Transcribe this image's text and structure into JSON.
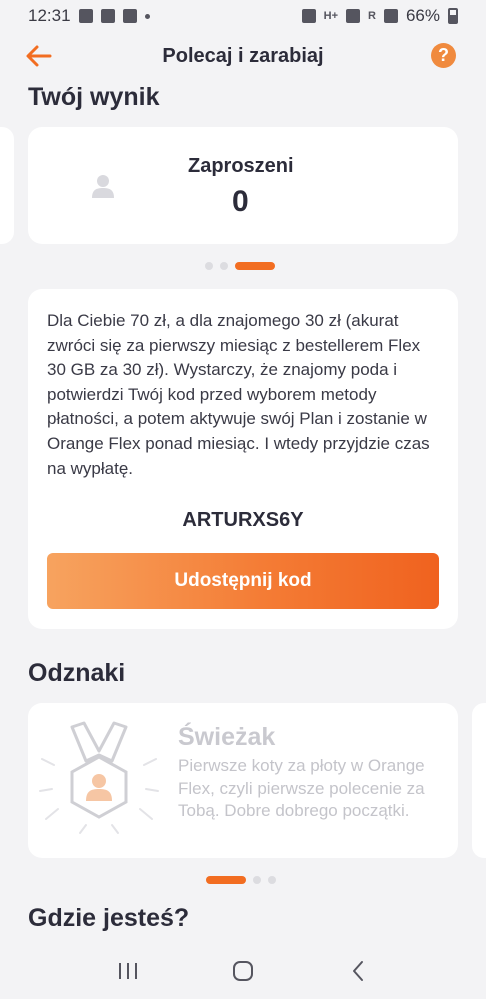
{
  "status_bar": {
    "time": "12:31",
    "battery": "66%",
    "signal_labels": [
      "H+",
      "R"
    ]
  },
  "header": {
    "title": "Polecaj i zarabiaj",
    "help_symbol": "?"
  },
  "score_section": {
    "title": "Twój wynik",
    "card": {
      "label": "Zaproszeni",
      "value": "0"
    },
    "pager": {
      "count": 3,
      "active_index": 2
    }
  },
  "referral": {
    "description": "Dla Ciebie 70 zł, a dla znajomego 30 zł (akurat zwróci się za pierwszy miesiąc z bestellerem Flex 30 GB za 30 zł). Wystarczy, że znajomy poda i potwierdzi Twój kod przed wyborem metody płatności, a potem aktywuje swój Plan i zostanie w Orange Flex ponad miesiąc. I wtedy przyjdzie czas na wypłatę.",
    "code": "ARTURXS6Y",
    "share_button_label": "Udostępnij kod"
  },
  "badges_section": {
    "title": "Odznaki",
    "badge": {
      "name": "Świeżak",
      "description": "Pierwsze koty za płoty w Orange Flex, czyli pierwsze polecenie za Tobą. Dobre dobrego początki.",
      "icon": "medal-icon"
    },
    "pager": {
      "count": 3,
      "active_index": 0
    }
  },
  "location_section": {
    "title": "Gdzie jesteś?"
  },
  "nav_bar": {
    "icons": [
      "recent-apps-icon",
      "home-icon",
      "back-nav-icon"
    ]
  },
  "colors": {
    "accent": "#f26d21",
    "text": "#2c2c3a",
    "background": "#f3f3f5"
  }
}
